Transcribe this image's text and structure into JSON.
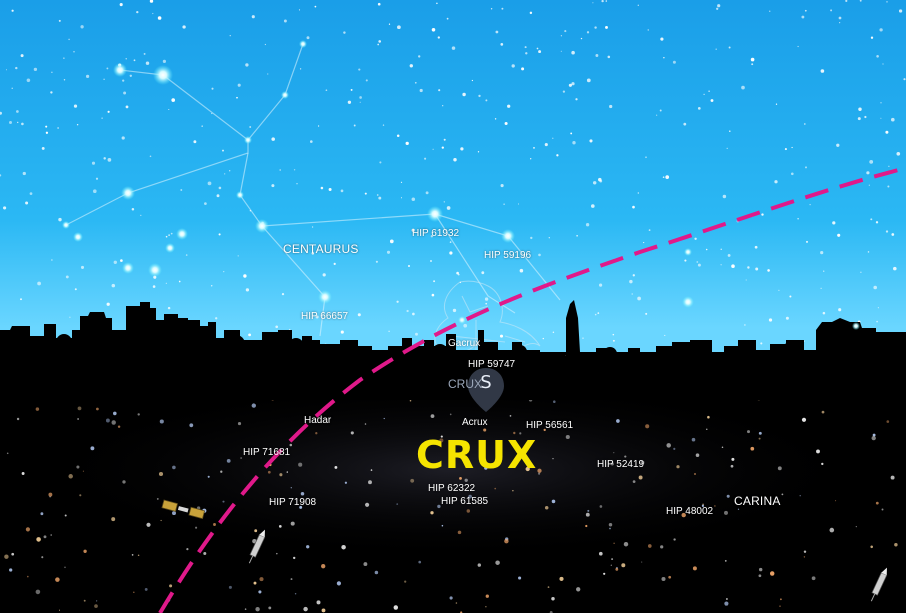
{
  "constellations": {
    "centaurus": "CENTAURUS",
    "crux_highlight": "CRUX",
    "crux_dim": "CRUX",
    "carina": "CARINA"
  },
  "stars": {
    "hip61932": "HIP 61932",
    "hip59196": "HIP 59196",
    "hip66657": "HIP 66657",
    "gacrux": "Gacrux",
    "hip59747": "HIP 59747",
    "hadar": "Hadar",
    "acrux": "Acrux",
    "hip56561": "HIP 56561",
    "hip71681": "HIP 71681",
    "hip52419": "HIP 52419",
    "hip62322": "HIP 62322",
    "hip61585": "HIP 61585",
    "hip71908": "HIP 71908",
    "hip48002": "HIP 48002"
  },
  "compass": {
    "direction": "S"
  },
  "icons": {
    "satellite": "satellite-icon",
    "rocket": "rocket-icon",
    "rocket_corner": "rocket-icon"
  },
  "colors": {
    "sky_top": "#1aa3f0",
    "sky_horizon": "#5fd4ff",
    "ground": "#000000",
    "ecliptic": "#e0198a",
    "highlight": "#f5e400"
  }
}
